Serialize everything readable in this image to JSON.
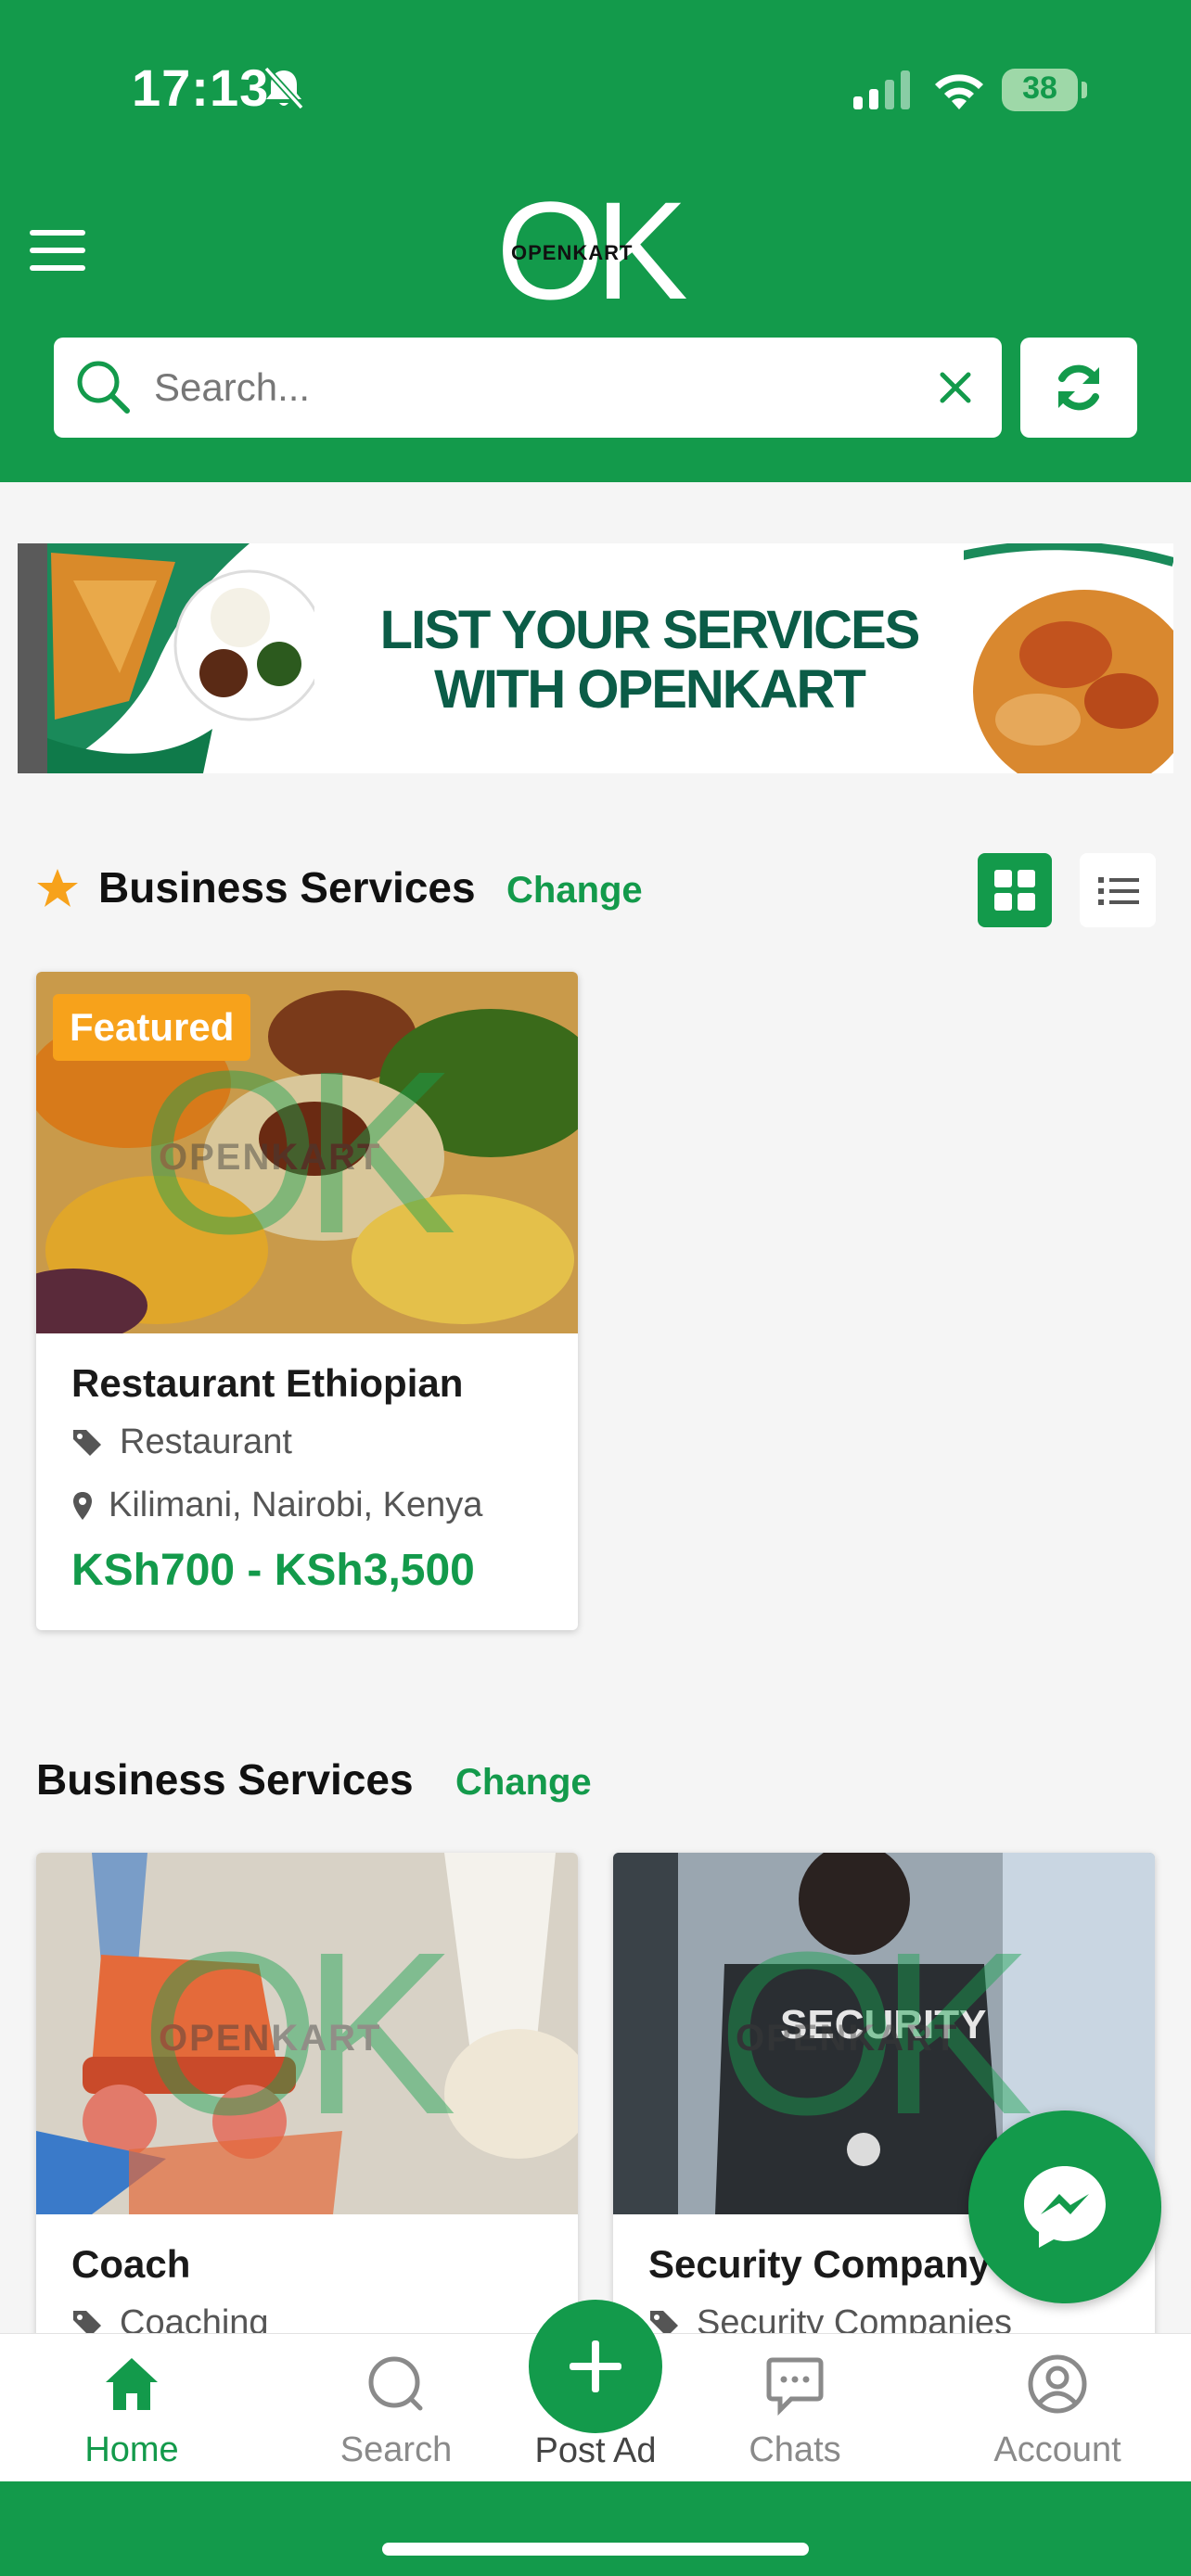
{
  "status_bar": {
    "time": "17:13",
    "battery": "38"
  },
  "app": {
    "logo_letters": "OK",
    "logo_word": "OPENKART"
  },
  "search": {
    "placeholder": "Search..."
  },
  "banner": {
    "line1": "LIST YOUR SERVICES",
    "line2": "WITH OPENKART"
  },
  "featured_section": {
    "title": "Business Services",
    "change_label": "Change",
    "items": [
      {
        "badge": "Featured",
        "title": "Restaurant Ethiopian",
        "category": "Restaurant",
        "location": "Kilimani, Nairobi, Kenya",
        "price": "KSh700 - KSh3,500"
      }
    ]
  },
  "services_section": {
    "title": "Business Services",
    "change_label": "Change",
    "items": [
      {
        "title": "Coach",
        "category": "Coaching"
      },
      {
        "title": "Security Company",
        "category": "Security Companies"
      }
    ]
  },
  "watermark": {
    "letters": "OK",
    "word": "OPENKART"
  },
  "bottom_nav": {
    "items": [
      {
        "label": "Home",
        "icon": "home-icon"
      },
      {
        "label": "Search",
        "icon": "search-icon"
      },
      {
        "label": "Post Ad",
        "icon": "plus-icon"
      },
      {
        "label": "Chats",
        "icon": "chat-icon"
      },
      {
        "label": "Account",
        "icon": "user-icon"
      }
    ]
  },
  "colors": {
    "brand": "#139a4b",
    "badge": "#f7a21b",
    "star": "#f7a21b"
  }
}
